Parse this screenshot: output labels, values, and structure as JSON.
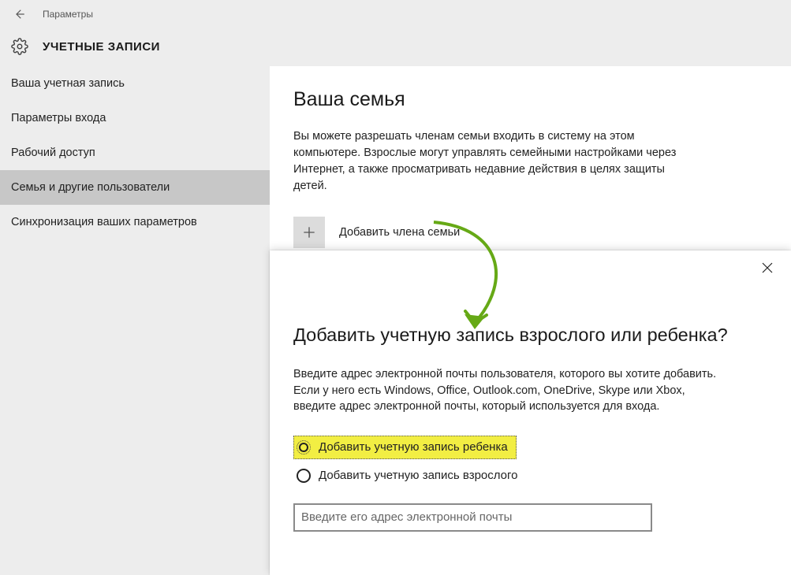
{
  "header": {
    "app_title": "Параметры"
  },
  "page": {
    "title": "УЧЕТНЫЕ ЗАПИСИ"
  },
  "sidebar": {
    "items": [
      {
        "label": "Ваша учетная запись"
      },
      {
        "label": "Параметры входа"
      },
      {
        "label": "Рабочий доступ"
      },
      {
        "label": "Семья и другие пользователи"
      },
      {
        "label": "Синхронизация ваших параметров"
      }
    ],
    "active_index": 3
  },
  "main": {
    "section_title": "Ваша семья",
    "section_desc": "Вы можете разрешать членам семьи входить в систему на этом компьютере. Взрослые могут управлять семейными настройками через Интернет, а также просматривать недавние действия в целях защиты детей.",
    "add_member_label": "Добавить члена семьи"
  },
  "dialog": {
    "title": "Добавить учетную запись взрослого или ребенка?",
    "desc": "Введите адрес электронной почты пользователя, которого вы хотите добавить. Если у него есть Windows, Office, Outlook.com, OneDrive, Skype или Xbox, введите адрес электронной почты, который используется для входа.",
    "options": [
      {
        "label": "Добавить учетную запись ребенка"
      },
      {
        "label": "Добавить учетную запись взрослого"
      }
    ],
    "email_placeholder": "Введите его адрес электронной почты"
  },
  "colors": {
    "highlight": "#f2ee43",
    "arrow": "#66a916"
  }
}
